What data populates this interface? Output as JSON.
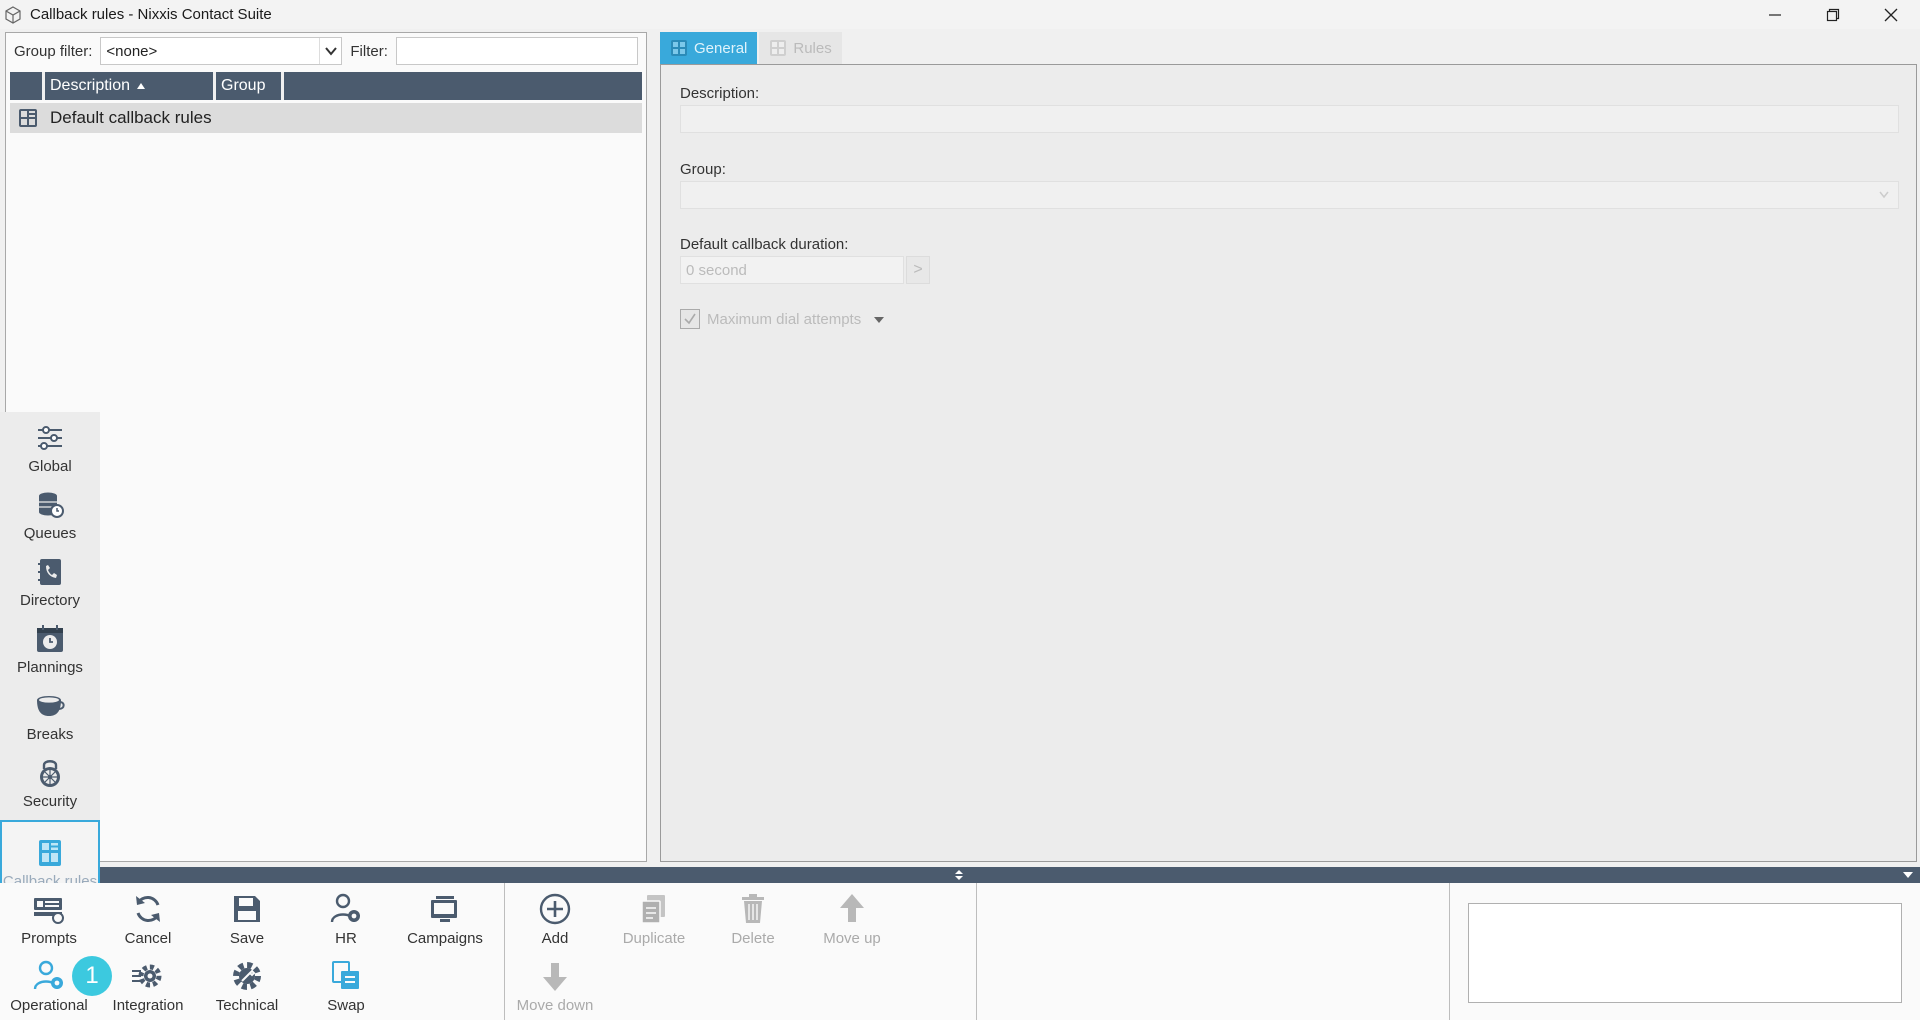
{
  "window": {
    "title": "Callback rules - Nixxis Contact Suite"
  },
  "left_panel": {
    "group_filter_label": "Group filter:",
    "group_filter_value": "<none>",
    "filter_label": "Filter:",
    "filter_value": "",
    "columns": [
      "Description",
      "Group"
    ],
    "rows": [
      {
        "description": "Default callback rules",
        "group": ""
      }
    ]
  },
  "tabs": [
    {
      "label": "General",
      "active": true
    },
    {
      "label": "Rules",
      "active": false
    }
  ],
  "form": {
    "description_label": "Description:",
    "description_value": "",
    "group_label": "Group:",
    "group_value": "",
    "duration_label": "Default callback duration:",
    "duration_placeholder": "0 second",
    "duration_button": ">",
    "max_dial_label": "Maximum dial attempts",
    "max_dial_checked": true
  },
  "side_nav": [
    {
      "label": "Global",
      "icon": "sliders-icon"
    },
    {
      "label": "Queues",
      "icon": "database-clock-icon"
    },
    {
      "label": "Directory",
      "icon": "phone-book-icon"
    },
    {
      "label": "Plannings",
      "icon": "calendar-clock-icon"
    },
    {
      "label": "Breaks",
      "icon": "coffee-cup-icon"
    },
    {
      "label": "Security",
      "icon": "padlock-icon"
    },
    {
      "label": "Callback rules",
      "icon": "callback-rules-icon",
      "selected": true
    }
  ],
  "toolbar": {
    "row1": [
      {
        "label": "Prompts",
        "icon": "prompts-icon"
      },
      {
        "label": "Cancel",
        "icon": "refresh-icon"
      },
      {
        "label": "Save",
        "icon": "save-icon"
      },
      {
        "label": "HR",
        "icon": "hr-user-gear-icon"
      },
      {
        "label": "Campaigns",
        "icon": "campaigns-icon"
      }
    ],
    "row2": [
      {
        "label": "Operational",
        "icon": "operational-user-gear-icon"
      },
      {
        "label": "Integration",
        "icon": "integration-gear-icon"
      },
      {
        "label": "Technical",
        "icon": "technical-gear-icon"
      },
      {
        "label": "Swap",
        "icon": "swap-icon"
      }
    ],
    "actions": [
      {
        "label": "Add",
        "icon": "plus-circle-icon",
        "enabled": true
      },
      {
        "label": "Duplicate",
        "icon": "duplicate-icon",
        "enabled": false
      },
      {
        "label": "Delete",
        "icon": "trash-icon",
        "enabled": false
      },
      {
        "label": "Move up",
        "icon": "arrow-up-icon",
        "enabled": false
      },
      {
        "label": "Move down",
        "icon": "arrow-down-icon",
        "enabled": false
      }
    ],
    "badge": "1"
  },
  "colors": {
    "accent": "#39a9db",
    "header": "#4b5b6e",
    "badge": "#3cc9df"
  }
}
